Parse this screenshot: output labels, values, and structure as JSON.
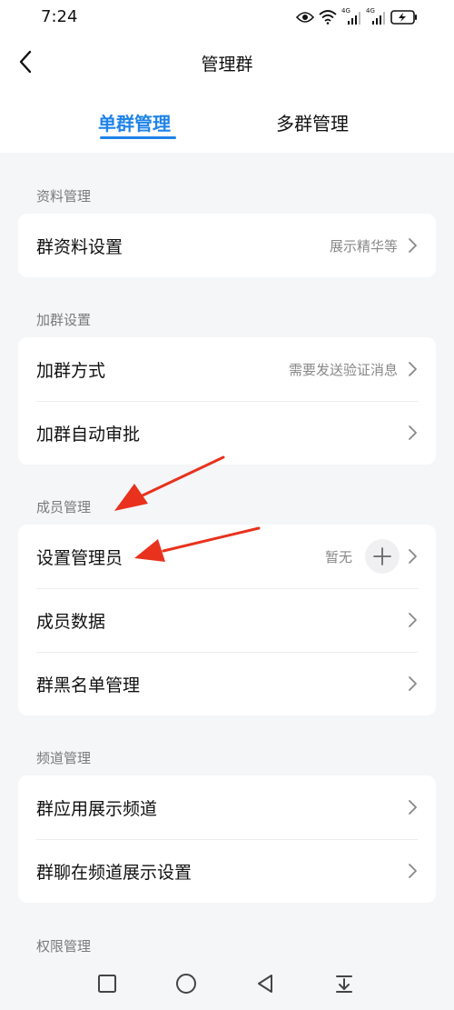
{
  "status_bar": {
    "time": "7:24",
    "network_1": "4G",
    "network_2": "4G"
  },
  "header": {
    "title": "管理群",
    "back_icon": "chevron-left-icon"
  },
  "tabs": [
    {
      "label": "单群管理",
      "active": true
    },
    {
      "label": "多群管理",
      "active": false
    }
  ],
  "sections": [
    {
      "title": "资料管理",
      "items": [
        {
          "label": "群资料设置",
          "value": "展示精华等"
        }
      ]
    },
    {
      "title": "加群设置",
      "items": [
        {
          "label": "加群方式",
          "value": "需要发送验证消息"
        },
        {
          "label": "加群自动审批",
          "value": ""
        }
      ]
    },
    {
      "title": "成员管理",
      "items": [
        {
          "label": "设置管理员",
          "value": "暂无",
          "has_add_button": true
        },
        {
          "label": "成员数据",
          "value": ""
        },
        {
          "label": "群黑名单管理",
          "value": ""
        }
      ]
    },
    {
      "title": "频道管理",
      "items": [
        {
          "label": "群应用展示频道",
          "value": ""
        },
        {
          "label": "群聊在频道展示设置",
          "value": ""
        }
      ]
    },
    {
      "title": "权限管理",
      "items": []
    }
  ],
  "bottom_nav": [
    "square-recents-icon",
    "circle-home-icon",
    "triangle-back-icon",
    "download-icon"
  ],
  "colors": {
    "accent": "#1f83e8",
    "annotation_arrow": "#e8321e",
    "background": "#f5f6f8"
  }
}
